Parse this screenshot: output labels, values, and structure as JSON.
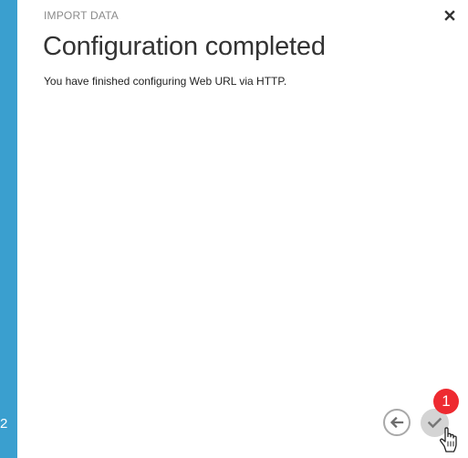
{
  "sidebar": {
    "accent_color": "#3a9fcf",
    "step_label": "2"
  },
  "dialog": {
    "label": "IMPORT DATA",
    "title": "Configuration completed",
    "message": "You have finished configuring Web URL via HTTP.",
    "close_icon": "close-icon"
  },
  "footer": {
    "back_icon": "arrow-left-icon",
    "done_icon": "checkmark-icon",
    "annotation_badge": "1",
    "badge_color": "#ee2a30"
  }
}
